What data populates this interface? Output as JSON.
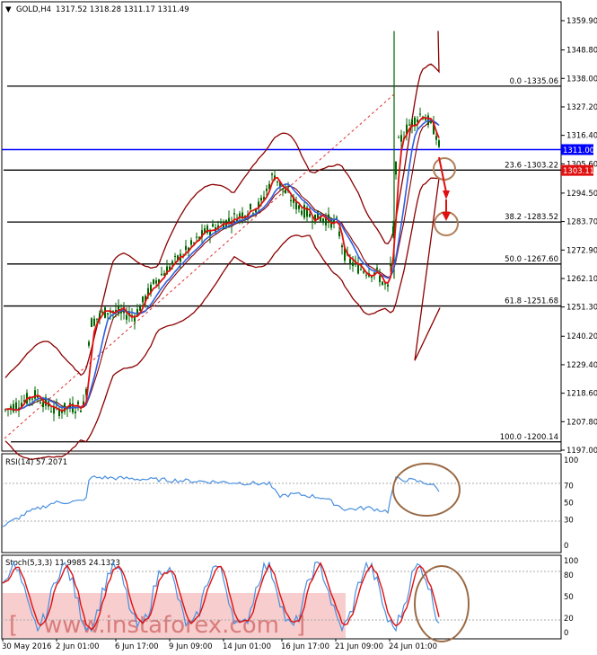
{
  "window": {
    "symbol_header": "GOLD,H4",
    "ohlc": "1317.52 1318.28 1311.17 1311.49"
  },
  "main_panel": {
    "price_axis": [
      1359.9,
      1348.8,
      1338.0,
      1327.2,
      1316.4,
      1305.6,
      1294.5,
      1283.7,
      1272.9,
      1262.1,
      1251.3,
      1240.2,
      1229.4,
      1218.6,
      1207.8,
      1197.0
    ],
    "fib_levels": [
      {
        "label": "0.0 -1335.06",
        "price": 1335.06
      },
      {
        "label": "23.6 -1303.22",
        "price": 1303.22
      },
      {
        "label": "38.2 -1283.52",
        "price": 1283.52
      },
      {
        "label": "50.0 -1267.60",
        "price": 1267.6
      },
      {
        "label": "61.8 -1251.68",
        "price": 1251.68
      },
      {
        "label": "100.0 -1200.14",
        "price": 1200.14
      }
    ],
    "blue_level": {
      "label": "1311.00",
      "price": 1311.0
    },
    "current_price": {
      "label": "1303.11",
      "price": 1303.11
    }
  },
  "rsi_panel": {
    "label": "RSI(14) 57.2071",
    "axis": [
      100,
      70,
      50,
      30,
      0
    ]
  },
  "stoch_panel": {
    "label": "Stoch(5,3,3) 11.9985 24.1323",
    "axis": [
      100,
      80,
      50,
      20,
      0
    ]
  },
  "time_axis": [
    "30 May 2016",
    "2 Jun 01:00",
    "6 Jun 17:00",
    "9 Jun 09:00",
    "14 Jun 01:00",
    "16 Jun 17:00",
    "21 Jun 09:00",
    "24 Jun 01:00"
  ],
  "watermark": "www.instaforex.com",
  "chart_data": {
    "type": "line",
    "title": "GOLD,H4",
    "x": [
      "30 May 2016",
      "2 Jun 01:00",
      "6 Jun 17:00",
      "9 Jun 09:00",
      "14 Jun 01:00",
      "16 Jun 17:00",
      "21 Jun 09:00",
      "24 Jun 01:00"
    ],
    "series": [
      {
        "name": "GOLD,H4",
        "values": [
          1212,
          1214,
          1248,
          1278,
          1292,
          1289,
          1270,
          1311.49
        ]
      },
      {
        "name": "RSI(14)",
        "values": [
          40,
          52,
          75,
          74,
          72,
          55,
          40,
          57.2071
        ]
      },
      {
        "name": "Stoch(5,3,3)",
        "values": [
          40,
          60,
          70,
          60,
          80,
          50,
          20,
          11.9985
        ]
      }
    ],
    "ylim": [
      1197.0,
      1359.9
    ],
    "colors": {
      "candles": "#006400",
      "ma_red": "#e01010",
      "ma_blue": "#3060e0",
      "bands": "#8b0000",
      "level": "#0000ff",
      "circle": "#b0805a"
    }
  }
}
